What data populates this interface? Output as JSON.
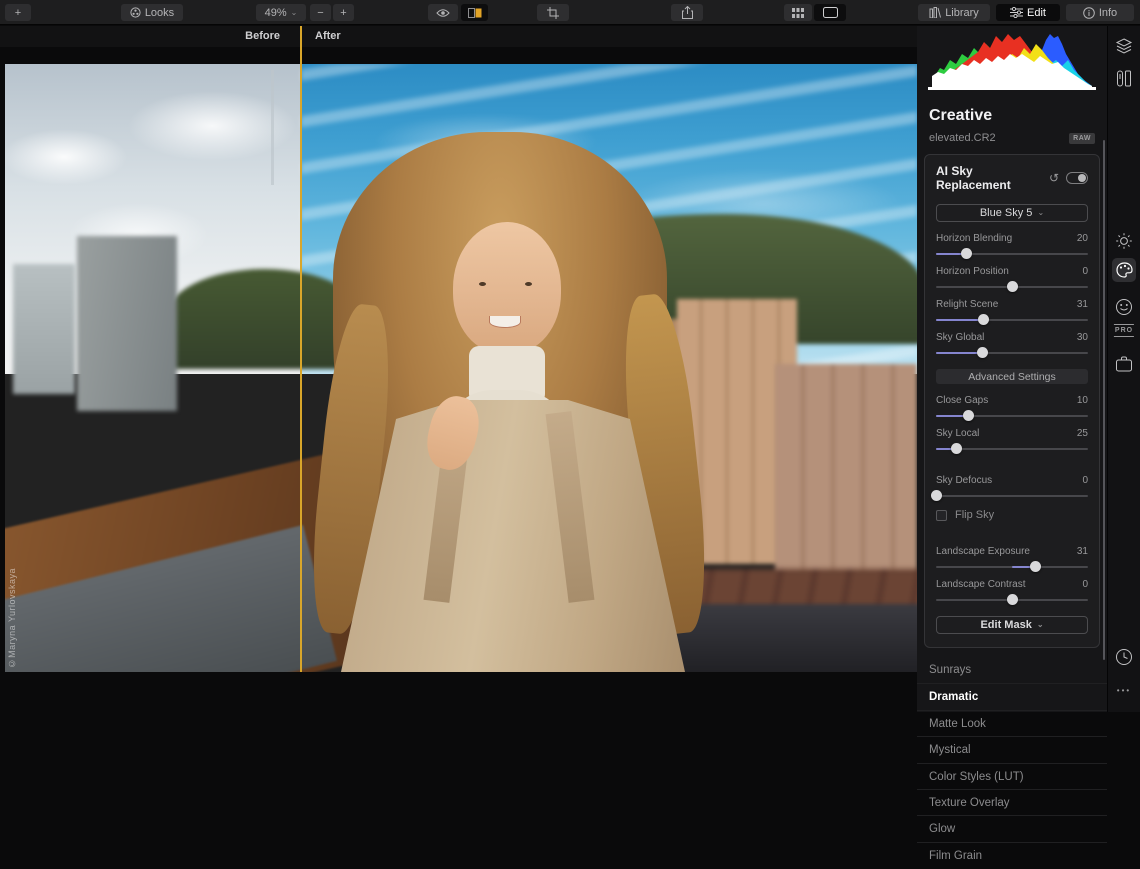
{
  "toolbar": {
    "add": "+",
    "looks": "Looks",
    "zoom": "49%",
    "minus": "−",
    "plus": "+",
    "library": "Library",
    "edit": "Edit",
    "info": "Info"
  },
  "compare": {
    "before": "Before",
    "after": "After"
  },
  "photo": {
    "watermark": "©Maryna Yurlovskaya"
  },
  "panel": {
    "title": "Creative",
    "filename": "elevated.CR2",
    "raw_badge": "RAW",
    "tool": {
      "title": "AI Sky Replacement",
      "preset_label": "Blue Sky 5",
      "advanced": "Advanced Settings",
      "flip_sky": "Flip Sky",
      "edit_mask": "Edit Mask",
      "sliders": [
        {
          "label": "Horizon Blending",
          "value": "20",
          "pos": 20,
          "fill": [
            0,
            20
          ]
        },
        {
          "label": "Horizon Position",
          "value": "0",
          "pos": 50,
          "fill": [
            50,
            50
          ]
        },
        {
          "label": "Relight Scene",
          "value": "31",
          "pos": 31,
          "fill": [
            0,
            31
          ]
        },
        {
          "label": "Sky Global",
          "value": "30",
          "pos": 30,
          "fill": [
            0,
            30
          ]
        },
        {
          "label": "Close Gaps",
          "value": "10",
          "pos": 21,
          "fill": [
            0,
            21
          ]
        },
        {
          "label": "Sky Local",
          "value": "25",
          "pos": 13,
          "fill": [
            0,
            13
          ]
        },
        {
          "label": "Sky Defocus",
          "value": "0",
          "pos": 0,
          "fill": [
            0,
            0
          ]
        },
        {
          "label": "Landscape Exposure",
          "value": "31",
          "pos": 65,
          "fill": [
            50,
            65
          ]
        },
        {
          "label": "Landscape Contrast",
          "value": "0",
          "pos": 50,
          "fill": [
            50,
            50
          ]
        }
      ]
    },
    "sections": [
      {
        "label": "Sunrays",
        "active": false
      },
      {
        "label": "Dramatic",
        "active": true
      },
      {
        "label": "Matte Look",
        "active": false
      },
      {
        "label": "Mystical",
        "active": false
      },
      {
        "label": "Color Styles (LUT)",
        "active": false
      },
      {
        "label": "Texture Overlay",
        "active": false
      },
      {
        "label": "Glow",
        "active": false
      },
      {
        "label": "Film Grain",
        "active": false
      }
    ]
  },
  "rail": {
    "pro": "PRO"
  },
  "icons": {
    "chevron": "⌄",
    "reset": "↺",
    "dots": "•••"
  },
  "colors": {
    "accent": "#d9a62a",
    "slider_fill": "#8585cf"
  }
}
